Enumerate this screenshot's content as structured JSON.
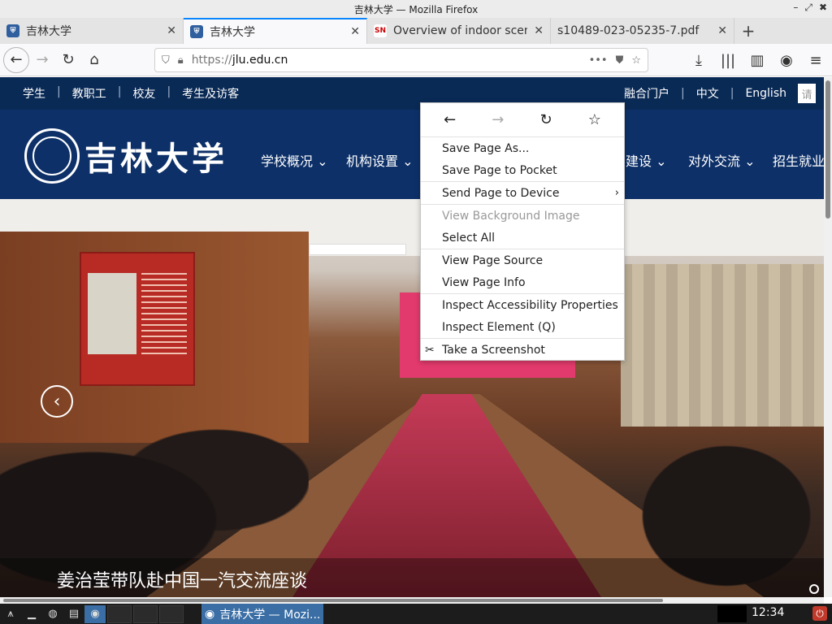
{
  "window": {
    "title": "吉林大学 — Mozilla Firefox"
  },
  "tabs": [
    {
      "label": "吉林大学",
      "icon": "jlu-favicon",
      "active": false
    },
    {
      "label": "吉林大学",
      "icon": "jlu-favicon",
      "active": true
    },
    {
      "label": "Overview of indoor scen",
      "icon": "sn-favicon",
      "active": false
    },
    {
      "label": "s10489-023-05235-7.pdf",
      "icon": "",
      "active": false
    }
  ],
  "navbar": {
    "url_prefix": "https://",
    "url_host": "jlu.edu.cn"
  },
  "site": {
    "top_links": [
      "学生",
      "教职工",
      "校友",
      "考生及访客"
    ],
    "top_right": [
      "融合门户",
      "中文",
      "English"
    ],
    "search_stub": "请",
    "logo_name": "吉林大学",
    "nav": [
      "学校概况",
      "机构设置",
      "建设",
      "对外交流",
      "招生就业"
    ]
  },
  "hero": {
    "caption": "姜治莹带队赴中国一汽交流座谈"
  },
  "context_menu": {
    "items": [
      {
        "label": "Save Page As...",
        "disabled": false
      },
      {
        "label": "Save Page to Pocket",
        "disabled": false
      },
      {
        "label": "Send Page to Device",
        "disabled": false,
        "submenu": true
      },
      {
        "label": "View Background Image",
        "disabled": true
      },
      {
        "label": "Select All",
        "disabled": false
      },
      {
        "label": "View Page Source",
        "disabled": false
      },
      {
        "label": "View Page Info",
        "disabled": false
      },
      {
        "label": "Inspect Accessibility Properties",
        "disabled": false
      },
      {
        "label": "Inspect Element (Q)",
        "disabled": false
      },
      {
        "label": "Take a Screenshot",
        "disabled": false
      }
    ]
  },
  "taskbar": {
    "task_label": "吉林大学 — Mozi...",
    "clock": "12:34"
  },
  "colors": {
    "site_top": "#0a2a56",
    "site_head": "#0d3068",
    "tab_accent": "#0a84ff"
  }
}
